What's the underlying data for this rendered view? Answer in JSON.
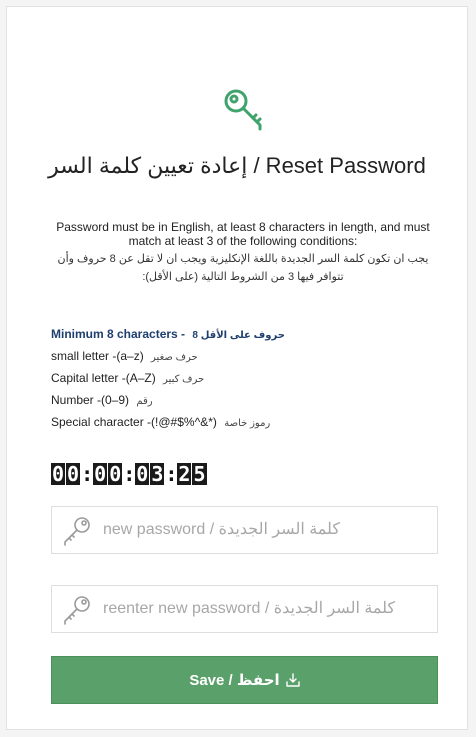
{
  "page": {
    "title": "إعادة تعيين كلمة السر / Reset Password"
  },
  "rules": {
    "english": "Password must be in English, at least 8 characters in length, and must match at least 3 of the following conditions:",
    "arabic": "يجب ان تكون كلمة السر الجديدة باللغة الإنكليزية ويجب ان لا تقل عن 8 حروف وأن تتوافر فيها 3 من الشروط التالية (على الأقل):"
  },
  "conditions": {
    "min_en": "Minimum 8 characters -",
    "min_ar": "8 حروف على الأقل",
    "items": [
      {
        "en": "small letter -(a–z)",
        "ar": "حرف صغير"
      },
      {
        "en": "Capital letter -(A–Z)",
        "ar": "حرف كبير"
      },
      {
        "en": "Number -(0–9)",
        "ar": "رقم"
      },
      {
        "en": "Special character -(!@#$%^&*)",
        "ar": "رموز خاصة"
      }
    ]
  },
  "timer": {
    "d": [
      "0",
      "0",
      "0",
      "0",
      "0",
      "3",
      "2",
      "5"
    ],
    "separator": ":"
  },
  "form": {
    "new_password_placeholder": "new password / كلمة السر الجديدة",
    "reenter_password_placeholder": "reenter new password / كلمة السر الجديدة",
    "save_label": "Save / احفظ"
  },
  "colors": {
    "accent_green": "#5aa06a",
    "icon_green": "#3fa36b",
    "conditions_title_blue": "#1f3f6f"
  },
  "icons": {
    "header": "key-icon",
    "field": "key-outline-icon",
    "save": "download-icon"
  }
}
